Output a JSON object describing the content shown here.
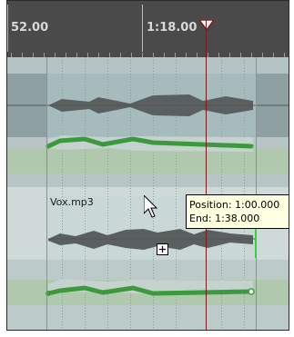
{
  "ruler": {
    "left_time": "52.00",
    "right_time": "1:18.00"
  },
  "item": {
    "name": "Vox.mp3"
  },
  "tooltip": {
    "position": "Position: 1:00.000",
    "end": "End: 1:38.000"
  },
  "colors": {
    "waveform": "#5a5f5f",
    "envelope": "#3b9a3b",
    "item_edge": "#2fd52f",
    "playhead": "#7a1a1a",
    "tooltip_bg": "#ffffe1"
  },
  "icons": {
    "pointer": "arrow-cursor-icon",
    "copy": "copy-plus-icon",
    "marker": "playhead-marker-icon"
  }
}
